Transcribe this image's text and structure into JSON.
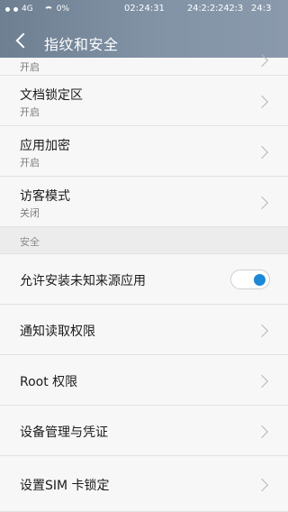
{
  "status_bar": {
    "network": "4G",
    "battery": "0%",
    "time_1": "02:24:31",
    "time_2": "24:2:2:242:3",
    "time_3": "24:3"
  },
  "header": {
    "title": "指纹和安全"
  },
  "items_top": [
    {
      "title": "",
      "subtitle": "开启"
    },
    {
      "title": "文档锁定区",
      "subtitle": "开启"
    },
    {
      "title": "应用加密",
      "subtitle": "开启"
    },
    {
      "title": "访客模式",
      "subtitle": "关闭"
    }
  ],
  "section_security": {
    "label": "安全"
  },
  "items_security": [
    {
      "title": "允许安装未知来源应用",
      "toggle_on": true
    },
    {
      "title": "通知读取权限"
    },
    {
      "title": "Root 权限"
    },
    {
      "title": "设备管理与凭证"
    },
    {
      "title": "设置SIM 卡锁定"
    }
  ],
  "colors": {
    "header_bg": "#7e8fa2",
    "toggle_accent": "#1e88d8"
  },
  "icons": [
    "back-arrow-icon",
    "wifi-icon",
    "chevron-right-icon"
  ]
}
